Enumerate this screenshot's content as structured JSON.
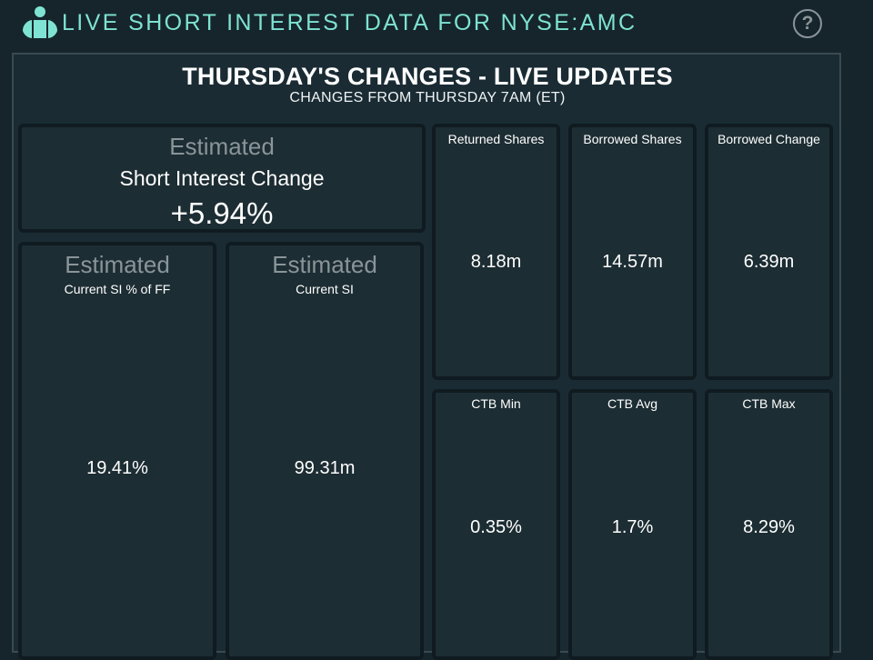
{
  "header": {
    "title": "LIVE SHORT INTEREST DATA FOR NYSE:AMC",
    "logo_icon": "info-person-icon",
    "help_icon": "question-circle-icon",
    "help_label": "?",
    "accent_color": "#7ee3d2"
  },
  "panel": {
    "title": "THURSDAY'S CHANGES - LIVE UPDATES",
    "subtitle": "CHANGES FROM THURSDAY 7AM (ET)"
  },
  "si_change": {
    "estimated": "Estimated",
    "label": "Short Interest Change",
    "value": "+5.94%"
  },
  "si_pct_ff": {
    "estimated": "Estimated",
    "label": "Current SI % of FF",
    "value": "19.41%"
  },
  "current_si": {
    "estimated": "Estimated",
    "label": "Current SI",
    "value": "99.31m"
  },
  "returned_shares": {
    "label": "Returned Shares",
    "value": "8.18m"
  },
  "borrowed_shares": {
    "label": "Borrowed Shares",
    "value": "14.57m"
  },
  "borrowed_change": {
    "label": "Borrowed Change",
    "value": "6.39m"
  },
  "ctb_min": {
    "label": "CTB Min",
    "value": "0.35%"
  },
  "ctb_avg": {
    "label": "CTB Avg",
    "value": "1.7%"
  },
  "ctb_max": {
    "label": "CTB Max",
    "value": "8.29%"
  }
}
